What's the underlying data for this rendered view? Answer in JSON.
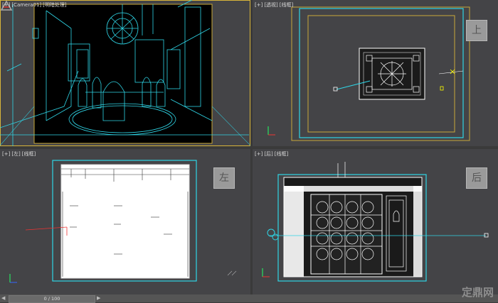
{
  "viewports": {
    "camera": {
      "plus": "[+]",
      "view": "[Camera01]",
      "shading": "[明暗处理]"
    },
    "top": {
      "plus": "[+]",
      "view": "[透视]",
      "shading": "[线框]",
      "cube": "上"
    },
    "left": {
      "plus": "[+]",
      "view": "[左]",
      "shading": "[线框]",
      "cube": "左"
    },
    "back": {
      "plus": "[+]",
      "view": "[后]",
      "shading": "[线框]",
      "cube": "后"
    }
  },
  "timeline": {
    "position": "0 / 100",
    "prev_icon": "chevron-left-icon",
    "next_icon": "chevron-right-icon"
  },
  "watermark": {
    "text": "定鼎网"
  },
  "colors": {
    "wire": "#2fd5e6",
    "frame": "#c9a83a",
    "bg": "#444447",
    "active": "#d8b43a"
  }
}
